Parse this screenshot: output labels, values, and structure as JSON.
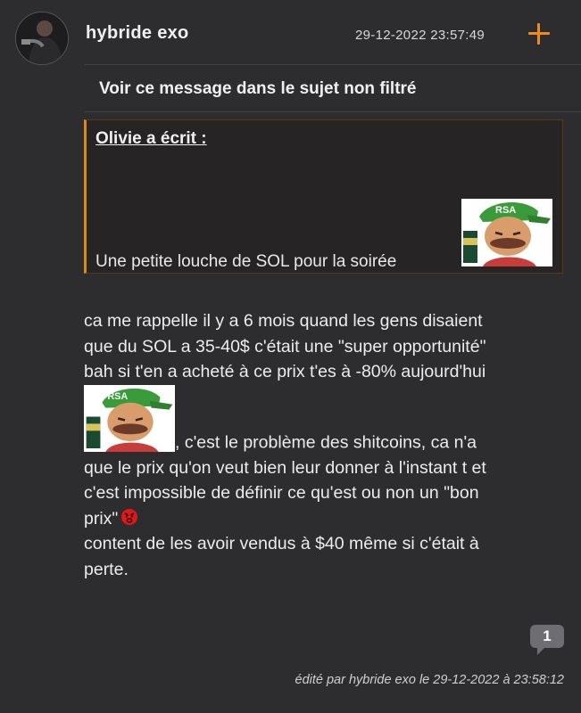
{
  "post": {
    "author": "hybride exo",
    "date": "29-12-2022 23:57:49",
    "unfiltered_link": "Voir ce message dans le sujet non filtré",
    "quote": {
      "author": "Olivie a écrit :",
      "text": "Une petite louche de SOL pour la soirée"
    },
    "body": {
      "line1": "ca me rappelle il y a 6 mois quand les gens disaient",
      "line2": "que du SOL a 35-40$ c'était une \"super opportunité\"",
      "line3": "bah si t'en a acheté à ce prix t'es à -80% aujourd'hui",
      "line4": ", c'est le problème des shitcoins, ca n'a",
      "line5": "que le prix qu'on veut bien leur donner à l'instant t et",
      "line6": "c'est impossible de définir ce qu'est ou non un \"bon",
      "line7": "prix\"",
      "line8": "content de les avoir vendus à $40 même si c'était à",
      "line9": "perte."
    },
    "sticker_cap_text": "RSA",
    "reply_count": "1",
    "edited": "édité par hybride exo le 29-12-2022 à 23:58:12"
  },
  "colors": {
    "background": "#2d2d2f",
    "accent": "#f08c1e",
    "quote_border": "#d98a1a",
    "text": "#ececec"
  },
  "icons": {
    "add": "plus-icon",
    "angry": "angry-face-icon",
    "replies": "speech-bubble-icon"
  }
}
